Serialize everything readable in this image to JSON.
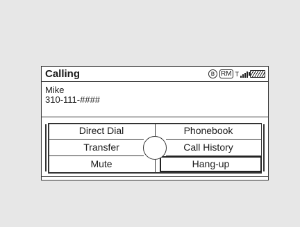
{
  "screen": {
    "title": "Calling",
    "status_icons": [
      "bluetooth-icon",
      "rm-icon",
      "signal-strength-icon",
      "battery-icon"
    ],
    "status": {
      "bluetooth_glyph": "ʙ",
      "rm_text": "RM",
      "signal_text": "T"
    }
  },
  "caller": {
    "name": "Mike",
    "number": "310-111-####"
  },
  "menu": {
    "direct_dial": "Direct Dial",
    "phonebook": "Phonebook",
    "transfer": "Transfer",
    "call_history": "Call History",
    "mute": "Mute",
    "hang_up": "Hang-up",
    "selected": "Hang-up"
  }
}
